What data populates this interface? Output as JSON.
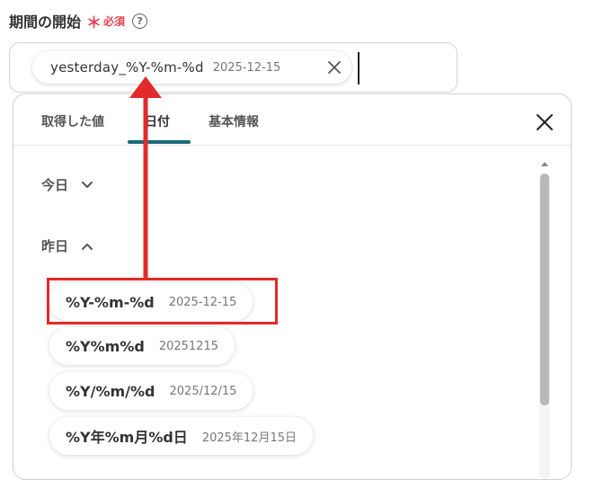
{
  "field": {
    "label": "期間の開始",
    "required_mark": "＊",
    "required_text": "必須",
    "help_glyph": "?"
  },
  "selected_chip": {
    "label": "yesterday_%Y-%m-%d",
    "value": "2025-12-15"
  },
  "tabs": [
    {
      "label": "取得した値",
      "active": false
    },
    {
      "label": "日付",
      "active": true
    },
    {
      "label": "基本情報",
      "active": false
    }
  ],
  "sections": {
    "today": {
      "label": "今日",
      "expanded": false
    },
    "yesterday": {
      "label": "昨日",
      "expanded": true
    }
  },
  "items": [
    {
      "label": "%Y-%m-%d",
      "value": "2025-12-15",
      "highlighted": true
    },
    {
      "label": "%Y%m%d",
      "value": "20251215",
      "highlighted": false
    },
    {
      "label": "%Y/%m/%d",
      "value": "2025/12/15",
      "highlighted": false
    },
    {
      "label": "%Y年%m月%d日",
      "value": "2025年12月15日",
      "highlighted": false
    }
  ],
  "colors": {
    "required": "#e5434f",
    "tab_accent": "#1b6a7a",
    "annotation": "#e32a2a"
  }
}
